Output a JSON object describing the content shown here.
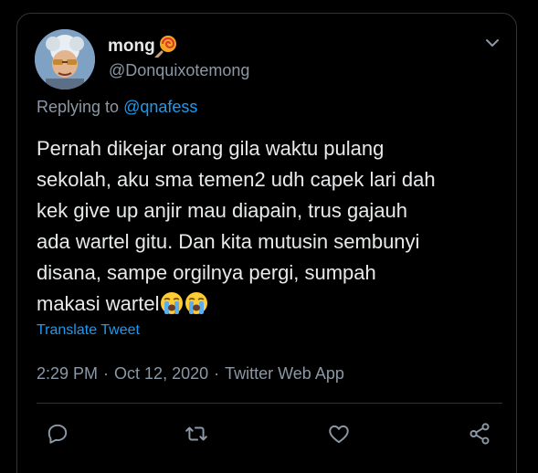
{
  "tweet": {
    "display_name": "mong",
    "name_emoji": "lollipop-icon",
    "handle": "@Donquixotemong",
    "replying_prefix": "Replying to ",
    "replying_mention": "@qnafess",
    "text_lines": [
      "Pernah dikejar orang gila waktu pulang",
      "sekolah, aku sma temen2 udh capek lari dah",
      "kek give up anjir mau diapain, trus gajauh",
      "ada wartel gitu. Dan kita mutusin sembunyi",
      "disana, sampe orgilnya pergi, sumpah",
      "makasi wartel"
    ],
    "text_trailing_emojis": [
      "loudly-crying-face-icon",
      "loudly-crying-face-icon"
    ],
    "translate_label": "Translate Tweet",
    "time": "2:29 PM",
    "date": "Oct 12, 2020",
    "source": "Twitter Web App",
    "separator": "·"
  },
  "actions": [
    "reply-icon",
    "retweet-icon",
    "like-icon",
    "share-icon"
  ],
  "colors": {
    "background": "#000000",
    "text": "#e7e9ea",
    "secondary": "#8b98a5",
    "link": "#1d9bf0",
    "border": "#2f3336"
  }
}
